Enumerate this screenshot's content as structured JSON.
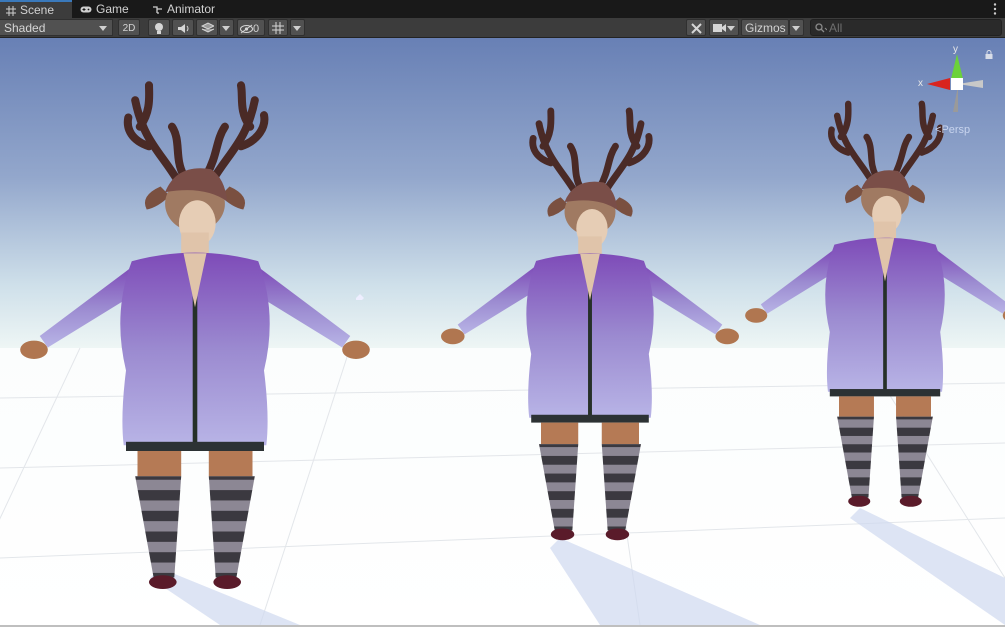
{
  "tabs": [
    {
      "label": "Scene",
      "icon": "grid-icon",
      "active": true
    },
    {
      "label": "Game",
      "icon": "gamepad-icon",
      "active": false
    },
    {
      "label": "Animator",
      "icon": "animator-icon",
      "active": false
    }
  ],
  "toolbar": {
    "shading_mode": "Shaded",
    "mode_2d_label": "2D",
    "hidden_count": "0",
    "gizmos_label": "Gizmos",
    "search_placeholder": "All"
  },
  "scene_gizmo": {
    "y_axis_label": "y",
    "x_axis_label": "x",
    "projection_label": "Persp"
  },
  "colors": {
    "tab_active_accent": "#3a79bb",
    "toolbar_bg": "#3c3c3c",
    "axis_x": "#d9241e",
    "axis_y": "#6bd23a",
    "sweater": "#8a6fc9",
    "stockings_dark": "#3b3940",
    "stockings_light": "#8c8794"
  }
}
